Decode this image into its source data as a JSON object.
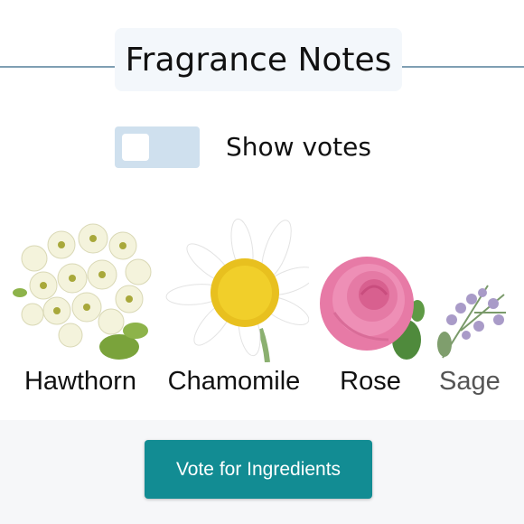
{
  "header": {
    "title": "Fragrance Notes"
  },
  "votes_toggle": {
    "label": "Show votes",
    "on": false
  },
  "ingredients": [
    {
      "name": "Hawthorn",
      "icon": "hawthorn-blossom-image"
    },
    {
      "name": "Chamomile",
      "icon": "chamomile-flower-image"
    },
    {
      "name": "Rose",
      "icon": "pink-rose-image"
    },
    {
      "name": "Sage",
      "icon": "sage-sprig-image"
    }
  ],
  "vote_button": {
    "label": "Vote for Ingredients"
  },
  "colors": {
    "title_bg": "#f3f7fb",
    "header_rule": "#7f9fb3",
    "toggle_track": "#cfe0ee",
    "button": "#128c93",
    "band": "#f6f7f9"
  }
}
